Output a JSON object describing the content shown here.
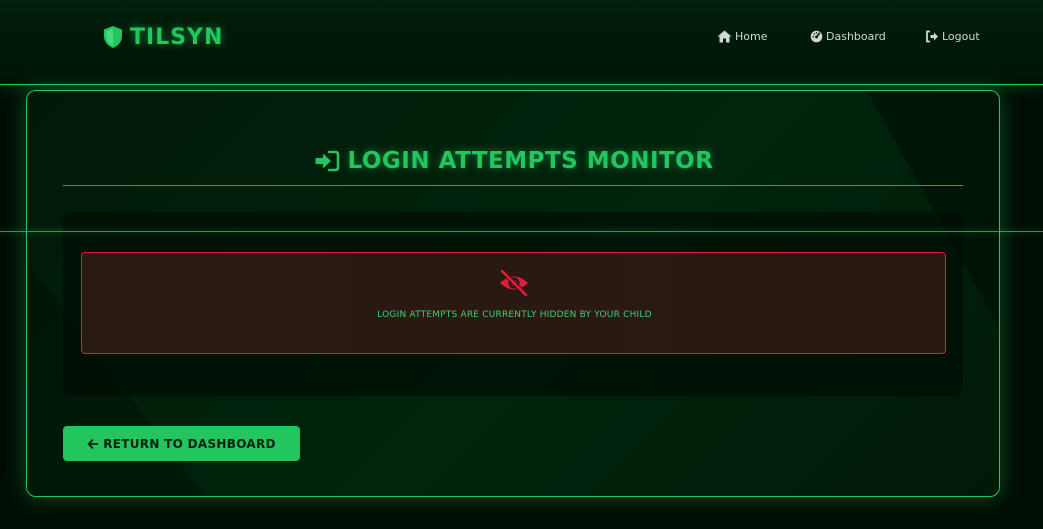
{
  "navbar": {
    "brand": "TILSYN",
    "brand_icon": "shield-icon",
    "links": [
      {
        "label": "Home",
        "icon": "home-icon"
      },
      {
        "label": "Dashboard",
        "icon": "dashboard-icon"
      },
      {
        "label": "Logout",
        "icon": "logout-icon"
      }
    ]
  },
  "card": {
    "title": "LOGIN ATTEMPTS MONITOR",
    "title_icon": "login-icon",
    "alert": {
      "icon": "eye-slash-icon",
      "message": "LOGIN ATTEMPTS ARE CURRENTLY HIDDEN BY YOUR CHILD"
    },
    "return_button": "RETURN TO DASHBOARD",
    "return_icon": "arrow-left-icon"
  },
  "colors": {
    "accent": "#22c55e",
    "danger": "#dc1f3a",
    "background": "#000d04"
  }
}
